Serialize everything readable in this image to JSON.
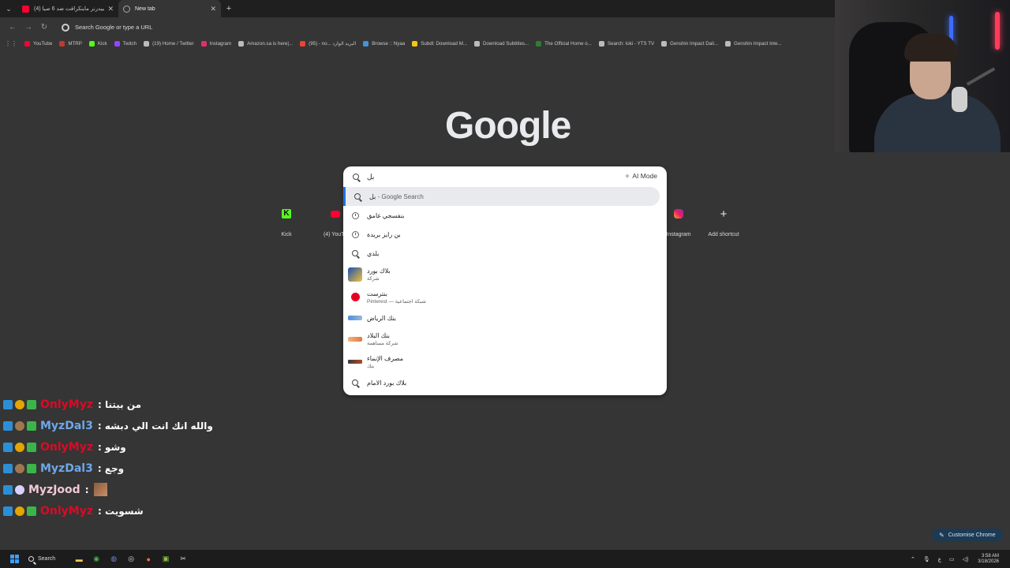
{
  "browser": {
    "tabs": [
      {
        "title": "(4) سبيدرنر ماينكرافت ضد 6 صيا...",
        "icon": "youtube-icon",
        "active": false
      },
      {
        "title": "New tab",
        "icon": "new-tab-icon",
        "active": true
      }
    ],
    "omnibox_placeholder": "Search Google or type a URL",
    "bookmarks": [
      {
        "label": "YouTube",
        "color": "#ff0033"
      },
      {
        "label": "MTRP",
        "color": "#c0392b"
      },
      {
        "label": "Kick",
        "color": "#53fc18"
      },
      {
        "label": "Twitch",
        "color": "#9146ff"
      },
      {
        "label": "(19) Home / Twitter",
        "color": "#bbbbbb"
      },
      {
        "label": "Instagram",
        "color": "#e1306c"
      },
      {
        "label": "Amazon.sa is here|...",
        "color": "#bbbbbb"
      },
      {
        "label": "(95) - no... البريد الوارد",
        "color": "#ea4335"
      },
      {
        "label": "Browse :: Nyaa",
        "color": "#4a90d9"
      },
      {
        "label": "Subdl: Download M...",
        "color": "#f5c518"
      },
      {
        "label": "Download Subtitles...",
        "color": "#bbbbbb"
      },
      {
        "label": "The Official Home o...",
        "color": "#2e7d32"
      },
      {
        "label": "Search: loki - YTS TV",
        "color": "#bbbbbb"
      },
      {
        "label": "Genshin Impact Dail...",
        "color": "#bbbbbb"
      },
      {
        "label": "Genshin Impact Inte...",
        "color": "#bbbbbb"
      }
    ]
  },
  "ntp": {
    "logo": "Google",
    "shortcuts": [
      {
        "label": "Kick",
        "icon": "kick-icon"
      },
      {
        "label": "(4) YouTu",
        "icon": "youtube-icon"
      },
      {
        "label": "Instagram",
        "icon": "instagram-icon"
      },
      {
        "label": "Add shortcut",
        "icon": "plus-icon"
      }
    ],
    "customise_label": "Customise Chrome"
  },
  "search": {
    "query": "بل",
    "ai_mode_label": "AI Mode",
    "suggestions": [
      {
        "type": "search",
        "text": "بل",
        "suffix": " - Google Search",
        "sub": ""
      },
      {
        "type": "history",
        "text": "بنفسجي غامق",
        "sub": ""
      },
      {
        "type": "history",
        "text": "بن رايز بريدة",
        "sub": ""
      },
      {
        "type": "search",
        "text": "بلدي",
        "sub": ""
      },
      {
        "type": "entity",
        "text": "بلاك بورد",
        "sub": "شركة"
      },
      {
        "type": "entity",
        "text": "بنترست",
        "sub": "Pinterest — شبكة اجتماعية"
      },
      {
        "type": "entity",
        "text": "بنك الرياض",
        "sub": ""
      },
      {
        "type": "entity",
        "text": "بنك البلاد",
        "sub": "شركة مساهمة"
      },
      {
        "type": "entity",
        "text": "مصرف الإنماء",
        "sub": "بنك"
      },
      {
        "type": "search",
        "text": "بلاك بورد الامام",
        "sub": ""
      }
    ]
  },
  "chat": [
    {
      "user": "OnlyMyz",
      "color": "#d90b25",
      "message": ": من بيتنا"
    },
    {
      "user": "MyzDal3",
      "color": "#6da7e8",
      "message": ": والله انك انت الي دبشه"
    },
    {
      "user": "OnlyMyz",
      "color": "#d90b25",
      "message": ": وشو"
    },
    {
      "user": "MyzDal3",
      "color": "#6da7e8",
      "message": ": وجع"
    },
    {
      "user": "MyzJood",
      "color": "#f0c8d8",
      "message": ":"
    },
    {
      "user": "OnlyMyz",
      "color": "#d90b25",
      "message": ": شسويت"
    }
  ],
  "taskbar": {
    "search_label": "Search",
    "time": "3:58 AM",
    "date": "3/18/2026",
    "lang": "ع"
  }
}
